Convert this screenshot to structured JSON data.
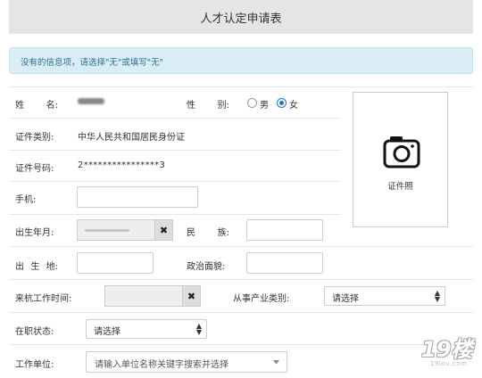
{
  "header": {
    "title": "人才认定申请表"
  },
  "alert": {
    "text": "没有的信息项，请选择\"无\"或填写\"无\""
  },
  "form": {
    "name": {
      "label_a": "姓",
      "label_b": "名:"
    },
    "gender": {
      "label_a": "性",
      "label_b": "别:",
      "options": [
        {
          "label": "男",
          "checked": false
        },
        {
          "label": "女",
          "checked": true
        }
      ]
    },
    "id_type": {
      "label": "证件类别:",
      "value": "中华人民共和国居民身份证"
    },
    "id_number": {
      "label": "证件号码:",
      "value": "2****************3"
    },
    "phone": {
      "label": "手机:",
      "value": ""
    },
    "birth": {
      "label": "出生年月:",
      "clear": "✖"
    },
    "ethnicity": {
      "label_a": "民",
      "label_b": "族:",
      "value": ""
    },
    "birthplace": {
      "label_a": "出",
      "label_b": "生",
      "label_c": "地:",
      "value": ""
    },
    "politics": {
      "label": "政治面貌:",
      "value": ""
    },
    "work_start": {
      "label": "来杭工作时间:",
      "clear": "✖"
    },
    "industry": {
      "label": "从事产业类别:",
      "selected": "请选择"
    },
    "job_status": {
      "label": "在职状态:",
      "selected": "请选择"
    },
    "employer": {
      "label": "工作单位:",
      "placeholder": "请输入单位名称关键字搜索并选择"
    }
  },
  "photo": {
    "label": "证件照"
  },
  "watermark": {
    "text": "19楼",
    "url": "19lou.com"
  },
  "icons": {
    "camera": "camera-icon",
    "clear": "clear-icon",
    "select_arrow": "updown-arrow-icon",
    "dropdown": "caret-down-icon"
  }
}
